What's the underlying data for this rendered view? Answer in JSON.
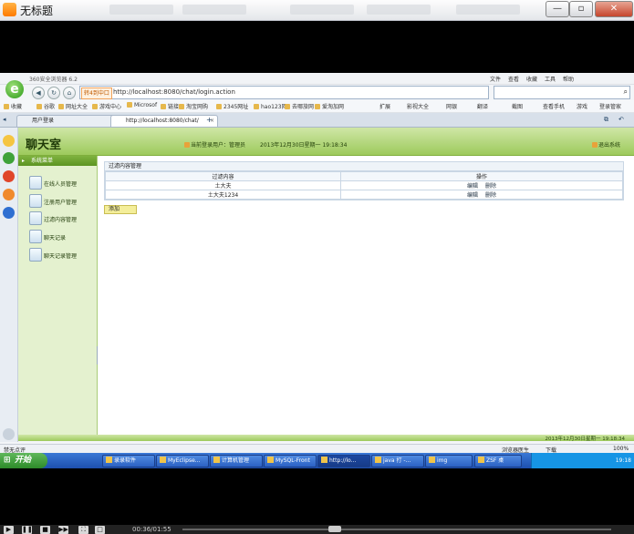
{
  "player": {
    "title": "无标题",
    "time": "00:36/01:55"
  },
  "browser": {
    "version": "360安全浏览器 6.2",
    "menus": [
      "文件",
      "查看",
      "收藏",
      "工具",
      "帮助"
    ],
    "address_tag": "转4到中口",
    "url": "http://localhost:8080/chat/login.action",
    "favorites": [
      "收藏",
      "谷歌",
      "网址大全",
      "游戏中心",
      "Microsof",
      "链接",
      "淘宝网购",
      "2345网址",
      "hao123网",
      "去哪旅网",
      "爱淘加网"
    ],
    "right_tools": [
      "扩展",
      "影视大全",
      "网银",
      "翻译",
      "截图",
      "查看手机",
      "游戏",
      "登录管家"
    ],
    "tabs": [
      {
        "label": "用户登录"
      },
      {
        "label": "http://localhost:8080/chat/"
      }
    ],
    "status_left": "禁无点评",
    "status_items": [
      "浏览器医生",
      "下载",
      "100%"
    ]
  },
  "app": {
    "title": "聊天室",
    "current_user": "当前登录用户：管理员",
    "date": "2013年12月30日星期一 19:18:34",
    "logout": "退出系统",
    "menu_header": "系统菜单",
    "menu": [
      "在线人员管理",
      "注册用户管理",
      "过滤内容管理",
      "聊天记录",
      "聊天记录管理"
    ],
    "panel_title": "过滤内容管理",
    "table": {
      "headers": [
        "过滤内容",
        "操作"
      ],
      "rows": [
        {
          "content": "土大夫",
          "edit": "编辑",
          "delete": "删除"
        },
        {
          "content": "土大夫1234",
          "edit": "编辑",
          "delete": "删除"
        }
      ]
    },
    "add_label": "添加",
    "footer_time": "2013年12月30日星期一 19:18:34"
  },
  "taskbar": {
    "start": "开始",
    "items": [
      "录录软件",
      "MyEclipse...",
      "计算机管理",
      "MySQL-Front",
      "http://lo...",
      "java 打 -...",
      "img",
      "ZSF 桌"
    ],
    "clock": "19:18"
  }
}
